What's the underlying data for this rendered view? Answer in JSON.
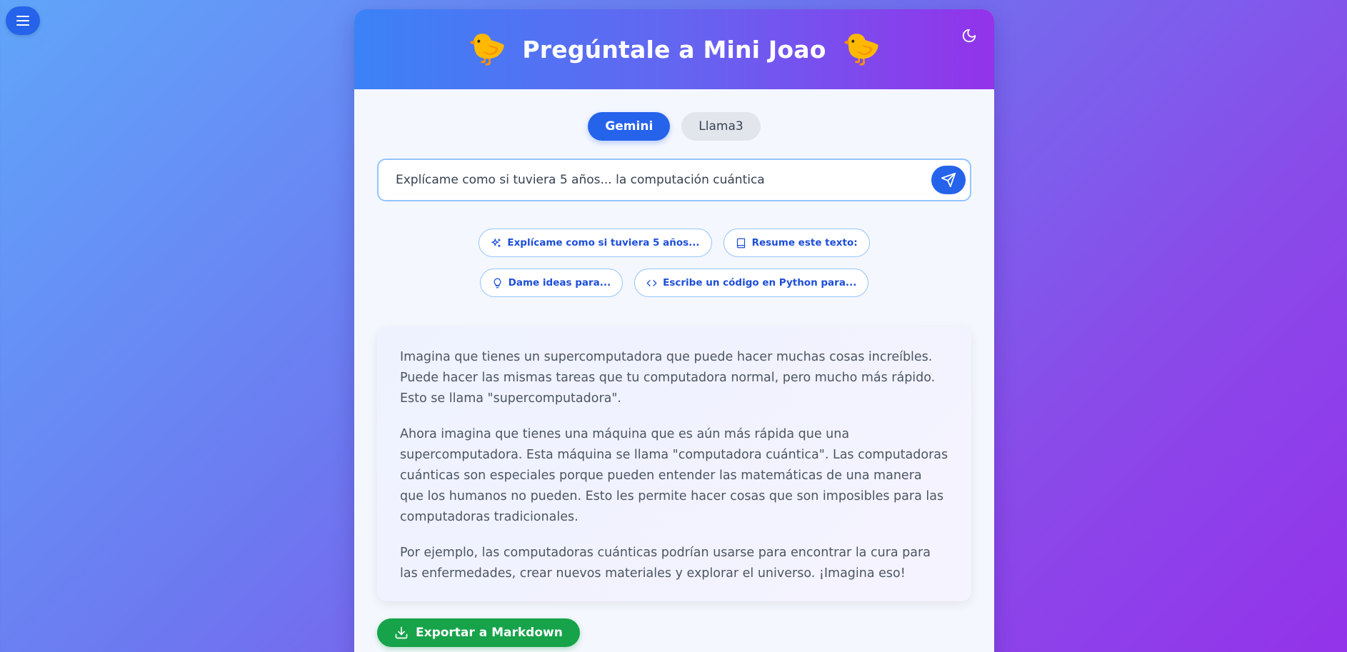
{
  "app": {
    "title": "Pregúntale a Mini Joao",
    "chick_emoji": "🐤"
  },
  "models": [
    {
      "label": "Gemini",
      "active": true
    },
    {
      "label": "Llama3",
      "active": false
    }
  ],
  "prompt": {
    "value": "Explícame como si tuviera 5 años... la computación cuántica",
    "placeholder": ""
  },
  "suggestions": [
    {
      "label": "Explícame como si tuviera 5 años...",
      "icon": "sparkles-icon"
    },
    {
      "label": "Resume este texto:",
      "icon": "book-icon"
    },
    {
      "label": "Dame ideas para...",
      "icon": "lightbulb-icon"
    },
    {
      "label": "Escribe un código en Python para...",
      "icon": "code-icon"
    }
  ],
  "response": {
    "paragraphs": [
      "Imagina que tienes un supercomputadora que puede hacer muchas cosas increíbles. Puede hacer las mismas tareas que tu computadora normal, pero mucho más rápido. Esto se llama \"supercomputadora\".",
      "Ahora imagina que tienes una máquina que es aún más rápida que una supercomputadora. Esta máquina se llama \"computadora cuántica\". Las computadoras cuánticas son especiales porque pueden entender las matemáticas de una manera que los humanos no pueden. Esto les permite hacer cosas que son imposibles para las computadoras tradicionales.",
      "Por ejemplo, las computadoras cuánticas podrían usarse para encontrar la cura para las enfermedades, crear nuevos materiales y explorar el universo. ¡Imagina eso!"
    ]
  },
  "export": {
    "label": "Exportar a Markdown",
    "icon": "download-icon"
  },
  "colors": {
    "primary": "#2563eb",
    "export_green": "#16a34a",
    "header_start": "#3b82f6",
    "header_end": "#9333ea"
  }
}
